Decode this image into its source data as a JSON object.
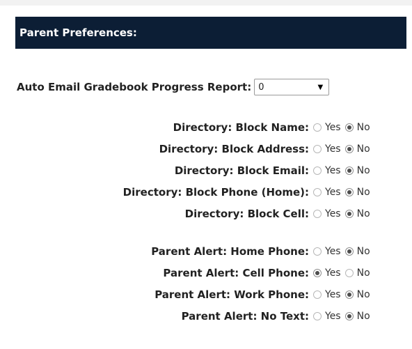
{
  "section": {
    "title": "Parent Preferences:"
  },
  "auto_email": {
    "label": "Auto Email Gradebook Progress Report:",
    "selected_value": "0"
  },
  "radio_labels": {
    "yes": "Yes",
    "no": "No"
  },
  "directory": [
    {
      "label": "Directory: Block Name:",
      "selected": "no"
    },
    {
      "label": "Directory: Block Address:",
      "selected": "no"
    },
    {
      "label": "Directory: Block Email:",
      "selected": "no"
    },
    {
      "label": "Directory: Block Phone (Home):",
      "selected": "no"
    },
    {
      "label": "Directory: Block Cell:",
      "selected": "no"
    }
  ],
  "alerts": [
    {
      "label": "Parent Alert: Home Phone:",
      "selected": "no"
    },
    {
      "label": "Parent Alert: Cell Phone:",
      "selected": "yes"
    },
    {
      "label": "Parent Alert: Work Phone:",
      "selected": "no"
    },
    {
      "label": "Parent Alert: No Text:",
      "selected": "no"
    }
  ],
  "colors": {
    "header_bg": "#0c1e35",
    "header_text": "#ffffff"
  }
}
